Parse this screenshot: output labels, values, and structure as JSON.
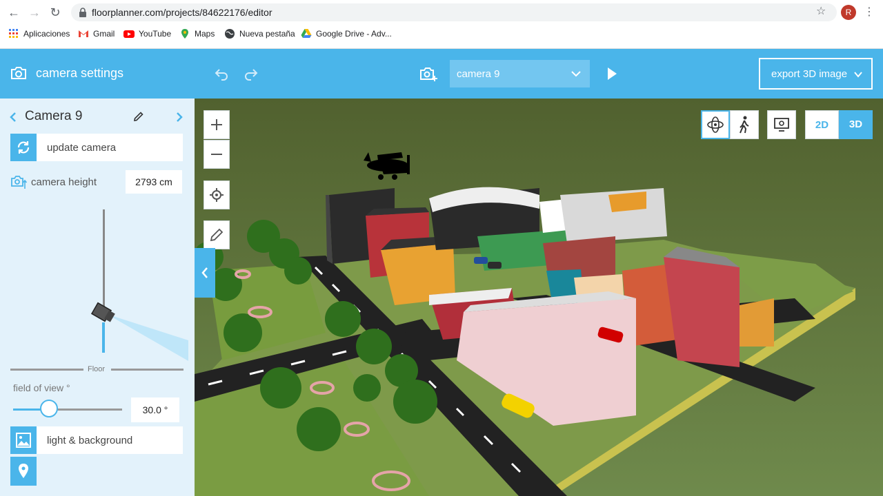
{
  "browser": {
    "url": "floorplanner.com/projects/84622176/editor",
    "avatar_letter": "R",
    "bookmarks": [
      {
        "label": "Aplicaciones",
        "icon": "apps-grid-icon"
      },
      {
        "label": "Gmail",
        "icon": "gmail-icon"
      },
      {
        "label": "YouTube",
        "icon": "youtube-icon"
      },
      {
        "label": "Maps",
        "icon": "maps-pin-icon"
      },
      {
        "label": "Nueva pestaña",
        "icon": "globe-icon"
      },
      {
        "label": "Google Drive - Adv...",
        "icon": "drive-icon"
      }
    ]
  },
  "panel": {
    "title": "camera settings",
    "camera_name": "Camera 9",
    "update_label": "update camera",
    "camera_height_label": "camera height",
    "camera_height_value": "2793 cm",
    "floor_label": "Floor",
    "fov_label": "field of view °",
    "fov_value": "30.0 °",
    "fov_fraction": 0.33,
    "light_label": "light & background"
  },
  "toolbar": {
    "camera_select": "camera 9",
    "export_label": "export 3D image"
  },
  "view": {
    "mode_2d": "2D",
    "mode_3d": "3D",
    "active_mode": "3D"
  },
  "colors": {
    "accent": "#4ab5ea",
    "panel_bg": "#e3f2fb",
    "ground": "#5b6e3f"
  }
}
